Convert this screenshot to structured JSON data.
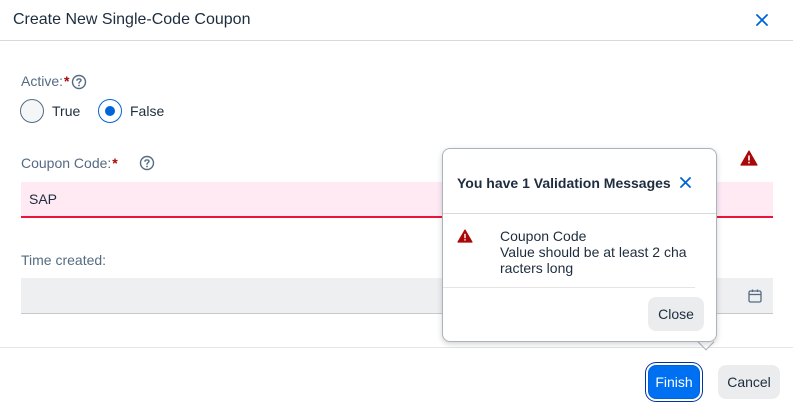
{
  "dialog": {
    "title": "Create New Single-Code Coupon"
  },
  "fields": {
    "active": {
      "label": "Active:",
      "required_mark": "*",
      "options": [
        {
          "label": "True",
          "selected": false
        },
        {
          "label": "False",
          "selected": true
        }
      ]
    },
    "coupon_code": {
      "label": "Coupon Code:",
      "required_mark": "*",
      "value": "SAP",
      "state": "error"
    },
    "time_created": {
      "label": "Time created:",
      "value": ""
    }
  },
  "popover": {
    "title": "You have 1 Validation Messages",
    "messages": [
      {
        "title": "Coupon Code",
        "text": "Value should be at least 2 characters long"
      }
    ],
    "close_label": "Close"
  },
  "footer": {
    "finish_label": "Finish",
    "cancel_label": "Cancel"
  },
  "colors": {
    "accent": "#0070f2",
    "error": "#e9153b",
    "warning_icon": "#aa0808",
    "error_field_bg": "#ffeaf4"
  }
}
